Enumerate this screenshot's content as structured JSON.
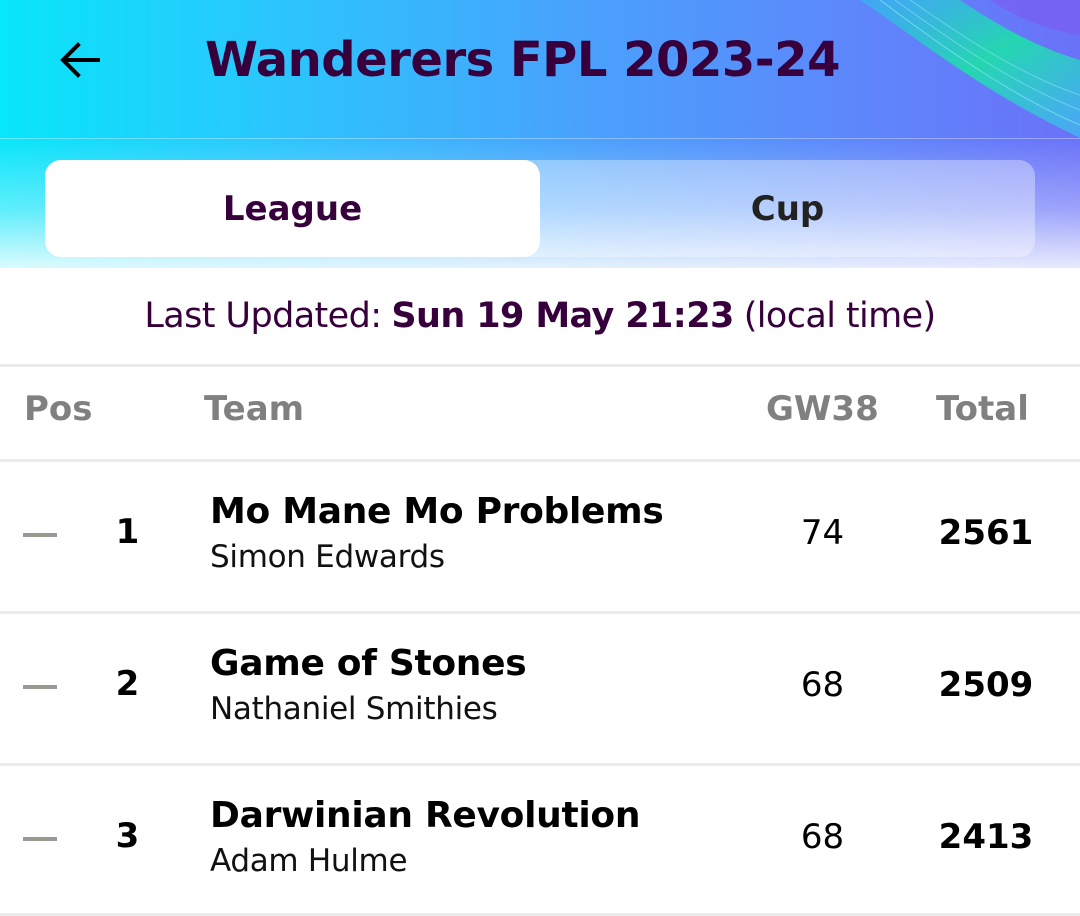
{
  "header": {
    "title": "Wanderers FPL 2023-24",
    "back_icon": "arrow-left-icon",
    "colors": {
      "gradient_start": "#08e6fa",
      "gradient_end": "#6a72f8",
      "title_text": "#37003c"
    }
  },
  "tabs": [
    {
      "label": "League",
      "active": true
    },
    {
      "label": "Cup",
      "active": false
    }
  ],
  "last_updated": {
    "prefix": "Last Updated:",
    "datetime": "Sun 19 May 21:23",
    "suffix": "(local time)"
  },
  "table": {
    "columns": {
      "pos": "Pos",
      "team": "Team",
      "gw": "GW38",
      "total": "Total"
    },
    "rows": [
      {
        "movement": "no-change",
        "rank": "1",
        "team": "Mo Mane Mo Problems",
        "manager": "Simon Edwards",
        "gw": "74",
        "total": "2561"
      },
      {
        "movement": "no-change",
        "rank": "2",
        "team": "Game of Stones",
        "manager": "Nathaniel Smithies",
        "gw": "68",
        "total": "2509"
      },
      {
        "movement": "no-change",
        "rank": "3",
        "team": "Darwinian Revolution",
        "manager": "Adam Hulme",
        "gw": "68",
        "total": "2413"
      }
    ]
  }
}
